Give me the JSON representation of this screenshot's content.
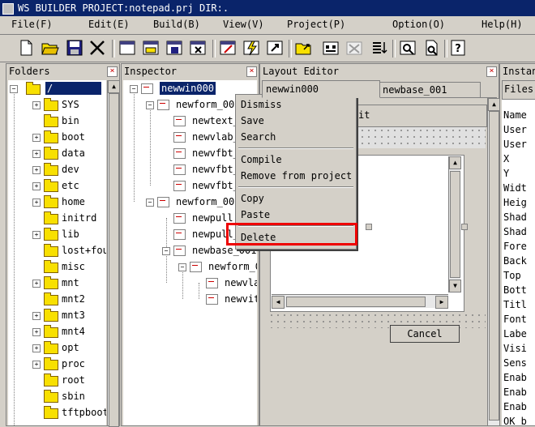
{
  "window": {
    "title": "WS BUILDER PROJECT:notepad.prj DIR:."
  },
  "menubar": [
    "File(F)",
    "Edit(E)",
    "Build(B)",
    "View(V)",
    "Project(P)",
    "Option(O)",
    "Help(H)"
  ],
  "toolbar_icons": [
    "new-file-icon",
    "open-folder-icon",
    "save-icon",
    "cut-icon",
    "new-window-icon",
    "open-window-icon",
    "save-window-icon",
    "close-window-icon",
    "edit-window-icon",
    "build-icon",
    "run-icon",
    "open-project-icon",
    "compile-icon",
    "tools-icon",
    "properties-icon",
    "find-icon",
    "preview-icon",
    "help-icon"
  ],
  "folders": {
    "title": "Folders",
    "items": [
      "/",
      "SYS",
      "bin",
      "boot",
      "data",
      "dev",
      "etc",
      "home",
      "initrd",
      "lib",
      "lost+fou",
      "misc",
      "mnt",
      "mnt2",
      "mnt3",
      "mnt4",
      "opt",
      "proc",
      "root",
      "sbin",
      "tftpboot"
    ]
  },
  "inspector": {
    "title": "Inspector",
    "items": [
      "newwin000",
      "newform_000",
      "newtext_",
      "newvlab_",
      "newvfbt_",
      "newvfbt_",
      "newvfbt_",
      "newform_002",
      "newpull_",
      "newpull_",
      "newbase_001",
      "newform_0",
      "newvla",
      "newvit"
    ]
  },
  "layout_editor": {
    "title": "Layout Editor",
    "tabs": [
      "newwin000",
      "newbase_001"
    ],
    "partial_label": "it",
    "cancel_label": "Cancel"
  },
  "instance": {
    "title": "Instan",
    "header": "Files",
    "rows": [
      "Name",
      "User",
      "User",
      "X",
      "Y",
      "Widt",
      "Heig",
      "Shad",
      "Shad",
      "Fore",
      "Back",
      "Top",
      "Bott",
      "Titl",
      "Font",
      "Labe",
      "Visi",
      "Sens",
      "Enab",
      "Enab",
      "Enab",
      "OK b"
    ]
  },
  "context_menu": {
    "items": [
      "Dismiss",
      "Save",
      "Search",
      "Compile",
      "Remove from project",
      "Copy",
      "Paste",
      "Delete"
    ]
  }
}
